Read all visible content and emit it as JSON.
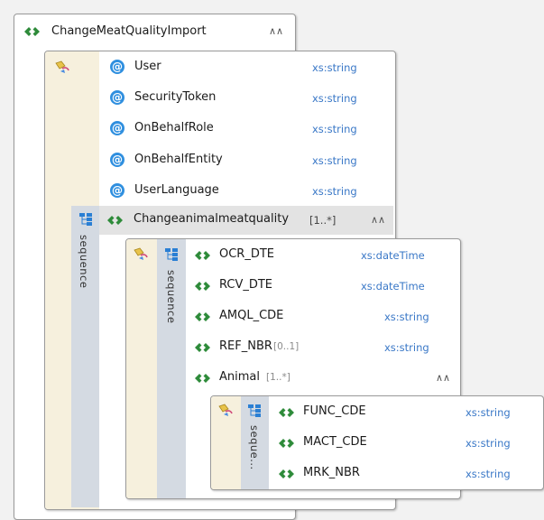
{
  "root": {
    "name": "ChangeMeatQualityImport",
    "collapse_glyph": "∧∧"
  },
  "attributes": [
    {
      "name": "User",
      "type": "xs:string"
    },
    {
      "name": "SecurityToken",
      "type": "xs:string"
    },
    {
      "name": "OnBehalfRole",
      "type": "xs:string"
    },
    {
      "name": "OnBehalfEntity",
      "type": "xs:string"
    },
    {
      "name": "UserLanguage",
      "type": "xs:string"
    }
  ],
  "seq1": {
    "label": "sequence",
    "element": {
      "name": "Changeanimalmeatquality",
      "card": "[1..*]",
      "collapse_glyph": "∧∧"
    }
  },
  "seq2": {
    "label": "sequence",
    "items": [
      {
        "name": "OCR_DTE",
        "card": "",
        "type": "xs:dateTime"
      },
      {
        "name": "RCV_DTE",
        "card": "",
        "type": "xs:dateTime"
      },
      {
        "name": "AMQL_CDE",
        "card": "",
        "type": "xs:string"
      },
      {
        "name": "REF_NBR",
        "card": "[0..1]",
        "type": "xs:string"
      }
    ],
    "animal": {
      "name": "Animal",
      "card": "[1..*]",
      "collapse_glyph": "∧∧"
    }
  },
  "seq3": {
    "label": "seque...",
    "items": [
      {
        "name": "FUNC_CDE",
        "type": "xs:string"
      },
      {
        "name": "MACT_CDE",
        "type": "xs:string"
      },
      {
        "name": "MRK_NBR",
        "type": "xs:string"
      }
    ]
  },
  "icons": {
    "element": "element-icon",
    "attribute": "attribute-icon",
    "attribute_group": "attribute-group-icon",
    "sequence": "sequence-icon"
  },
  "colors": {
    "type_text": "#3a78c7",
    "element_icon": "#2e8b3a",
    "attribute_icon": "#2f8fdf",
    "panel_sand": "#f6f0dd",
    "panel_gray": "#d4dae2"
  }
}
